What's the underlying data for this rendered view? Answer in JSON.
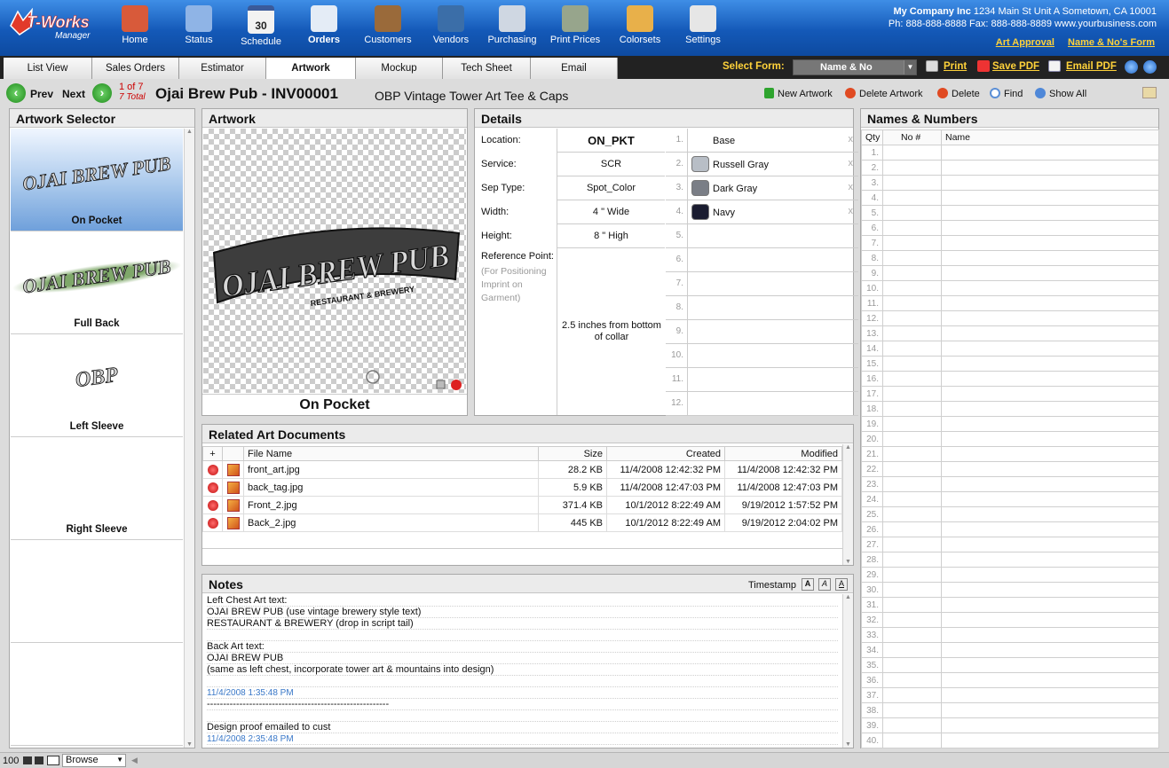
{
  "app": {
    "logo_line1": "T-Works",
    "logo_line2": "Manager"
  },
  "nav": [
    {
      "label": "Home",
      "icon": "home-icon",
      "color": "#d85a3a"
    },
    {
      "label": "Status",
      "icon": "status-flag-icon",
      "color": "#8fb4e6"
    },
    {
      "label": "Schedule",
      "icon": "calendar-icon",
      "color": "#f2f2f2",
      "badge": "30"
    },
    {
      "label": "Orders",
      "icon": "orders-icon",
      "color": "#e4ecf6",
      "active": true
    },
    {
      "label": "Customers",
      "icon": "address-book-icon",
      "color": "#9a6a3a"
    },
    {
      "label": "Vendors",
      "icon": "shirt-icon",
      "color": "#3b6ea8"
    },
    {
      "label": "Purchasing",
      "icon": "basket-icon",
      "color": "#cfd7e2"
    },
    {
      "label": "Print Prices",
      "icon": "calculator-icon",
      "color": "#97a58c"
    },
    {
      "label": "Colorsets",
      "icon": "palette-icon",
      "color": "#e8b04a"
    },
    {
      "label": "Settings",
      "icon": "settings-switch-icon",
      "color": "#e6e6e6"
    }
  ],
  "company": {
    "name": "My Company Inc",
    "address": "1234 Main St Unit A Sometown, CA 10001",
    "phone": "Ph: 888-888-8888 Fax: 888-888-8889 www.yourbusiness.com",
    "link_art_approval": "Art Approval",
    "link_names_form": "Name & No's Form"
  },
  "tabs": [
    "List View",
    "Sales Orders",
    "Estimator",
    "Artwork",
    "Mockup",
    "Tech Sheet",
    "Email"
  ],
  "active_tab": "Artwork",
  "select_form": {
    "label": "Select Form:",
    "value": "Name & No",
    "dropdown_glyph": "▼"
  },
  "toolbar": {
    "print": "Print",
    "save_pdf": "Save PDF",
    "email_pdf": "Email PDF"
  },
  "record": {
    "prev": "Prev",
    "next": "Next",
    "position": "1 of 7",
    "total": "7 Total",
    "customer": "Ojai Brew Pub - INV00001",
    "description": "OBP Vintage Tower Art Tee & Caps"
  },
  "actions": {
    "new_artwork": "New Artwork",
    "delete_artwork": "Delete Artwork",
    "delete": "Delete",
    "find": "Find",
    "show_all": "Show All"
  },
  "artwork_selector": {
    "title": "Artwork Selector",
    "items": [
      {
        "caption": "On Pocket",
        "art": "OJAI BREW PUB",
        "selected": true
      },
      {
        "caption": "Full Back",
        "art": "OJAI BREW PUB"
      },
      {
        "caption": "Left Sleeve",
        "art": "OBP"
      },
      {
        "caption": "Right Sleeve",
        "art": ""
      }
    ]
  },
  "artwork": {
    "title": "Artwork",
    "logo_text": "OJAI BREW PUB",
    "logo_sub": "RESTAURANT & BREWERY",
    "caption": "On Pocket"
  },
  "details": {
    "title": "Details",
    "fields": [
      {
        "label": "Location:",
        "value": "ON_PKT"
      },
      {
        "label": "Service:",
        "value": "SCR"
      },
      {
        "label": "Sep Type:",
        "value": "Spot_Color"
      },
      {
        "label": "Width:",
        "value": "4 \" Wide"
      },
      {
        "label": "Height:",
        "value": "8 \" High"
      }
    ],
    "reference_label": "Reference Point:",
    "reference_hint": "(For Positioning Imprint on Garment)",
    "reference_value": "2.5 inches from bottom of collar",
    "colors": [
      {
        "num": "1.",
        "name": "Base",
        "swatch": ""
      },
      {
        "num": "2.",
        "name": "Russell Gray",
        "swatch": "#b8bec6"
      },
      {
        "num": "3.",
        "name": "Dark Gray",
        "swatch": "#7a7e86"
      },
      {
        "num": "4.",
        "name": "Navy",
        "swatch": "#1a1c30"
      },
      {
        "num": "5.",
        "name": ""
      },
      {
        "num": "6.",
        "name": ""
      },
      {
        "num": "7.",
        "name": ""
      },
      {
        "num": "8.",
        "name": ""
      },
      {
        "num": "9.",
        "name": ""
      },
      {
        "num": "10.",
        "name": ""
      },
      {
        "num": "11.",
        "name": ""
      },
      {
        "num": "12.",
        "name": ""
      }
    ],
    "remove_glyph": "x"
  },
  "related": {
    "title": "Related Art Documents",
    "columns": [
      "File Name",
      "Size",
      "Created",
      "Modified"
    ],
    "rows": [
      {
        "file": "front_art.jpg",
        "size": "28.2 KB",
        "created": "11/4/2008 12:42:32 PM",
        "modified": "11/4/2008 12:42:32 PM"
      },
      {
        "file": "back_tag.jpg",
        "size": "5.9 KB",
        "created": "11/4/2008 12:47:03 PM",
        "modified": "11/4/2008 12:47:03 PM"
      },
      {
        "file": "Front_2.jpg",
        "size": "371.4 KB",
        "created": "10/1/2012 8:22:49 AM",
        "modified": "9/19/2012 1:57:52 PM"
      },
      {
        "file": "Back_2.jpg",
        "size": "445 KB",
        "created": "10/1/2012 8:22:49 AM",
        "modified": "9/19/2012 2:04:02 PM"
      }
    ]
  },
  "notes": {
    "title": "Notes",
    "timestamp_label": "Timestamp",
    "lines": [
      {
        "text": "Left Chest Art text:"
      },
      {
        "text": "OJAI BREW PUB (use vintage brewery style text)"
      },
      {
        "text": "RESTAURANT & BREWERY (drop in script tail)"
      },
      {
        "text": ""
      },
      {
        "text": "Back Art text:"
      },
      {
        "text": "OJAI BREW PUB"
      },
      {
        "text": "(same as left chest, incorporate tower art & mountains into design)"
      },
      {
        "text": ""
      },
      {
        "text": "11/4/2008 1:35:48 PM",
        "ts": true
      },
      {
        "text": "--------------------------------------------------------"
      },
      {
        "text": ""
      },
      {
        "text": "Design proof emailed to cust"
      },
      {
        "text": "11/4/2008 2:35:48 PM",
        "ts": true
      }
    ]
  },
  "names_numbers": {
    "title": "Names & Numbers",
    "columns": [
      "Qty",
      "No #",
      "Name"
    ],
    "rows": [
      "1.",
      "2.",
      "3.",
      "4.",
      "5.",
      "6.",
      "7.",
      "8.",
      "9.",
      "10.",
      "11.",
      "12.",
      "13.",
      "14.",
      "15.",
      "16.",
      "17.",
      "18.",
      "19.",
      "20.",
      "21.",
      "22.",
      "23.",
      "24.",
      "25.",
      "26.",
      "27.",
      "28.",
      "29.",
      "30.",
      "31.",
      "32.",
      "33.",
      "34.",
      "35.",
      "36.",
      "37.",
      "38.",
      "39.",
      "40."
    ]
  },
  "statusbar": {
    "zoom": "100",
    "mode": "Browse"
  }
}
